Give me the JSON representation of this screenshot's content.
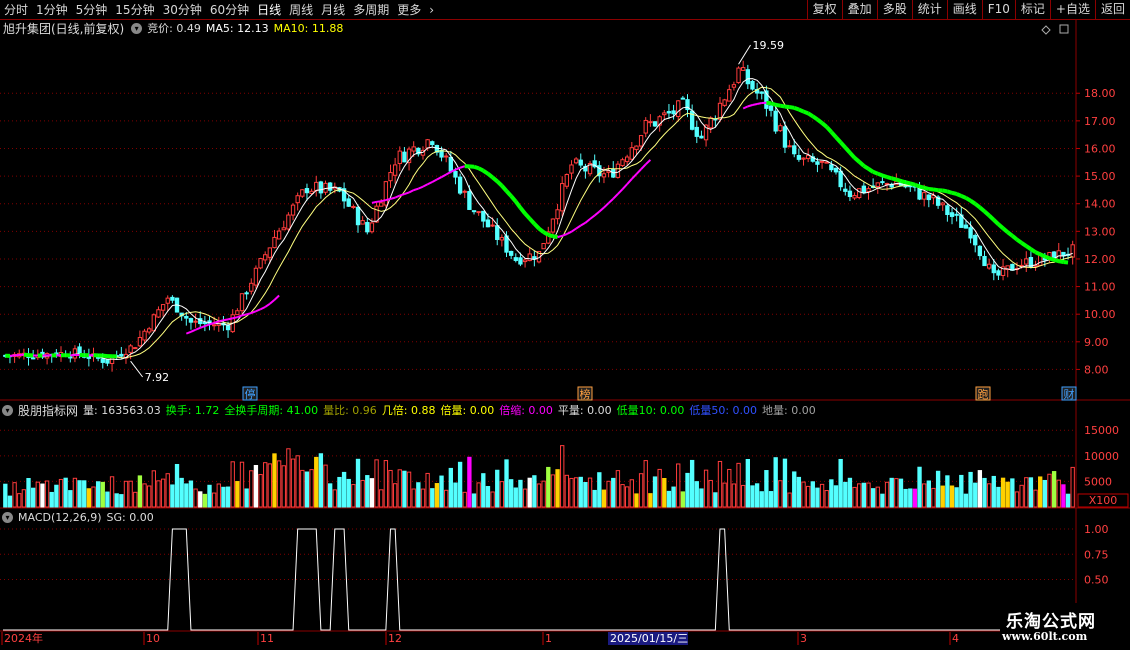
{
  "toolbar": {
    "periods": [
      "分时",
      "1分钟",
      "5分钟",
      "15分钟",
      "30分钟",
      "60分钟",
      "日线",
      "周线",
      "月线",
      "多周期",
      "更多"
    ],
    "active_period": "日线",
    "tools": [
      "复权",
      "叠加",
      "多股",
      "统计",
      "画线",
      "F10",
      "标记",
      "+自选",
      "返回"
    ]
  },
  "main_header": {
    "title": "旭升集团(日线,前复权)",
    "bid_label": "竞价: 0.49",
    "ma5_label": "MA5: 12.13",
    "ma10_label": "MA10: 11.88"
  },
  "vol_header": {
    "title": "股朋指标网",
    "items": [
      {
        "text": "量: 163563.03",
        "color": "#dcdcdc"
      },
      {
        "text": "换手: 1.72",
        "color": "#00ff00"
      },
      {
        "text": "全换手周期: 41.00",
        "color": "#00ff00"
      },
      {
        "text": "量比: 0.96",
        "color": "#a0a000"
      },
      {
        "text": "几倍: 0.88",
        "color": "#ffff00"
      },
      {
        "text": "倍量: 0.00",
        "color": "#ffff00"
      },
      {
        "text": "倍缩: 0.00",
        "color": "#ff00ff"
      },
      {
        "text": "平量: 0.00",
        "color": "#dcdcdc"
      },
      {
        "text": "低量10: 0.00",
        "color": "#00ff00"
      },
      {
        "text": "低量50: 0.00",
        "color": "#3050ff"
      },
      {
        "text": "地量: 0.00",
        "color": "#a0a0a0"
      }
    ]
  },
  "macd_header": {
    "title": "MACD(12,26,9)",
    "sg_label": "SG: 0.00"
  },
  "price_axis": [
    "18.00",
    "17.00",
    "16.00",
    "15.00",
    "14.00",
    "13.00",
    "12.00",
    "11.00",
    "10.00",
    "9.00",
    "8.00"
  ],
  "volume_axis": [
    "15000",
    "10000",
    "5000"
  ],
  "volume_unit": "X100",
  "macd_axis": [
    "1.00",
    "0.75",
    "0.50"
  ],
  "date_axis": [
    "2024年",
    "10",
    "11",
    "12",
    "1",
    "2025/01/15/三",
    "3",
    "4"
  ],
  "annotations": {
    "high": "19.59",
    "low": "7.92",
    "markers": [
      "停",
      "榜",
      "跑",
      "财"
    ]
  },
  "watermark": {
    "name": "乐淘公式网",
    "url": "www.60lt.com"
  },
  "colors": {
    "up": "#ff3c3c",
    "down": "#54ffff",
    "ma_slow": "#00ff00",
    "ma_white": "#ffffff",
    "ma_yellow": "#ffff80",
    "grid": "#800000",
    "magenta": "#ff00ff"
  },
  "icons": {
    "dropdown": "circle-dropdown-icon",
    "more": "chevron-right-icon",
    "settings": "diamond-icon"
  }
}
